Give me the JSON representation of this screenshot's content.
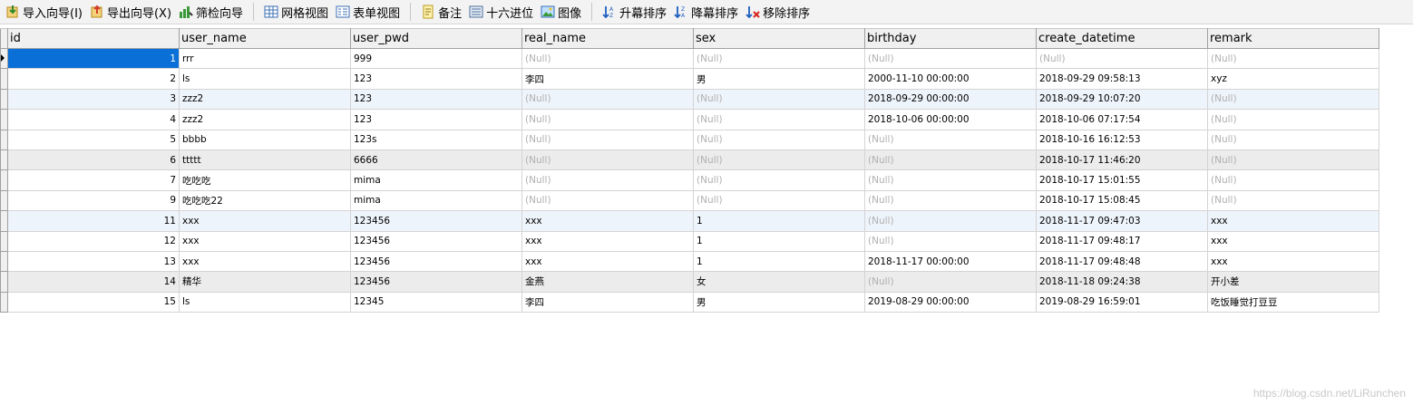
{
  "toolbar": {
    "items": [
      {
        "label": "导入向导(I)",
        "icon": "import-wizard-icon"
      },
      {
        "label": "导出向导(X)",
        "icon": "export-wizard-icon"
      },
      {
        "label": "筛检向导",
        "icon": "filter-wizard-icon"
      },
      {
        "label": "网格视图",
        "icon": "grid-view-icon"
      },
      {
        "label": "表单视图",
        "icon": "form-view-icon"
      },
      {
        "label": "备注",
        "icon": "memo-icon"
      },
      {
        "label": "十六进位",
        "icon": "hex-icon"
      },
      {
        "label": "图像",
        "icon": "image-icon"
      },
      {
        "label": "升幕排序",
        "icon": "sort-ascending-icon"
      },
      {
        "label": "降幕排序",
        "icon": "sort-descending-icon"
      },
      {
        "label": "移除排序",
        "icon": "remove-sort-icon"
      }
    ]
  },
  "grid": {
    "columns": [
      "id",
      "user_name",
      "user_pwd",
      "real_name",
      "sex",
      "birthday",
      "create_datetime",
      "remark"
    ],
    "null_text": "(Null)",
    "rows": [
      [
        "1",
        "rrr",
        "999",
        null,
        null,
        null,
        null,
        null
      ],
      [
        "2",
        "ls",
        "123",
        "李四",
        "男",
        "2000-11-10 00:00:00",
        "2018-09-29 09:58:13",
        "xyz"
      ],
      [
        "3",
        "zzz2",
        "123",
        null,
        null,
        "2018-09-29 00:00:00",
        "2018-09-29 10:07:20",
        null
      ],
      [
        "4",
        "zzz2",
        "123",
        null,
        null,
        "2018-10-06 00:00:00",
        "2018-10-06 07:17:54",
        null
      ],
      [
        "5",
        "bbbb",
        "123s",
        null,
        null,
        null,
        "2018-10-16 16:12:53",
        null
      ],
      [
        "6",
        "ttttt",
        "6666",
        null,
        null,
        null,
        "2018-10-17 11:46:20",
        null
      ],
      [
        "7",
        "吃吃吃",
        "mima",
        null,
        null,
        null,
        "2018-10-17 15:01:55",
        null
      ],
      [
        "9",
        "吃吃吃22",
        "mima",
        null,
        null,
        null,
        "2018-10-17 15:08:45",
        null
      ],
      [
        "11",
        "xxx",
        "123456",
        "xxx",
        "1",
        null,
        "2018-11-17 09:47:03",
        "xxx"
      ],
      [
        "12",
        "xxx",
        "123456",
        "xxx",
        "1",
        null,
        "2018-11-17 09:48:17",
        "xxx"
      ],
      [
        "13",
        "xxx",
        "123456",
        "xxx",
        "1",
        "2018-11-17 00:00:00",
        "2018-11-17 09:48:48",
        "xxx"
      ],
      [
        "14",
        "精华",
        "123456",
        "金燕",
        "女",
        null,
        "2018-11-18 09:24:38",
        "开小差"
      ],
      [
        "15",
        "ls",
        "12345",
        "李四",
        "男",
        "2019-08-29 00:00:00",
        "2019-08-29 16:59:01",
        "吃饭睡觉打豆豆"
      ]
    ]
  },
  "watermark": "https://blog.csdn.net/LiRunchen"
}
